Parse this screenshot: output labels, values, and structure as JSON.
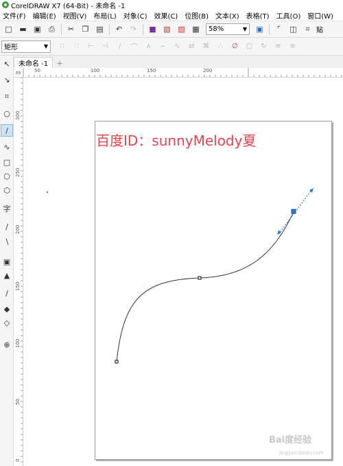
{
  "window": {
    "title": "CorelDRAW X7 (64-Bit) - 未命名 -1"
  },
  "menu": [
    "文件(F)",
    "编辑(E)",
    "视图(V)",
    "布局(L)",
    "对象(C)",
    "效果(C)",
    "位图(B)",
    "文本(X)",
    "表格(T)",
    "工具(O)",
    "窗口(W)"
  ],
  "toolbar": {
    "zoom": "58%",
    "last_label": "贴"
  },
  "propbar": {
    "shape_type": "矩形"
  },
  "doc_tab": {
    "name": "未命名 -1",
    "add": "+"
  },
  "ruler": {
    "corner": "㎜",
    "h_labels": [
      "50",
      "100",
      "150",
      "200"
    ],
    "v_labels": [
      "300",
      "250",
      "200",
      "150",
      "100",
      "50",
      "0"
    ]
  },
  "canvas": {
    "watermark_text": "百度ID：sunnyMelody夏"
  },
  "footer_watermark": {
    "brand": "Bai度经验",
    "url": "jingyan.baidu.com"
  }
}
